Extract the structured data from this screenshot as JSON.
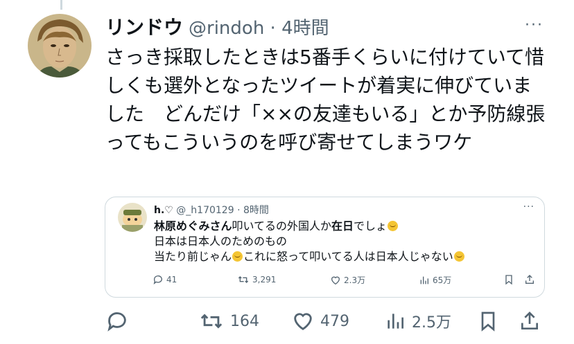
{
  "tweet": {
    "author_name": "リンドウ",
    "handle_time": "@rindoh · 4時間",
    "more": "···",
    "text": "さっき採取したときは5番手くらいに付けていて惜しくも選外となったツイートが着実に伸びていました　どんだけ「××の友達もいる」とか予防線張ってもこういうのを呼び寄せてしまうワケ"
  },
  "quote": {
    "author_name": "h.♡",
    "handle_time": "@_h170129 · 8時間",
    "more": "···",
    "line1": {
      "bold": "林原めぐみさん",
      "mid": "叩いてるの外国人か",
      "bold2": "在日",
      "end": "でしょ"
    },
    "line2": "日本は日本人のためのもの",
    "line3a": "当たり前じゃん",
    "line3b": "これに怒って叩いてる人は日本人じゃない",
    "actions": {
      "replies": "41",
      "reposts": "3,291",
      "likes": "2.3万",
      "views": "65万"
    }
  },
  "actions": {
    "reposts": "164",
    "likes": "479",
    "views": "2.5万"
  },
  "icons": [
    "reply-icon",
    "repost-icon",
    "like-icon",
    "views-icon",
    "bookmark-icon",
    "share-icon",
    "more-icon",
    "emoji-icon"
  ],
  "colors": {
    "text": "#0f1419",
    "secondary": "#536471",
    "border": "#cfd9de"
  }
}
